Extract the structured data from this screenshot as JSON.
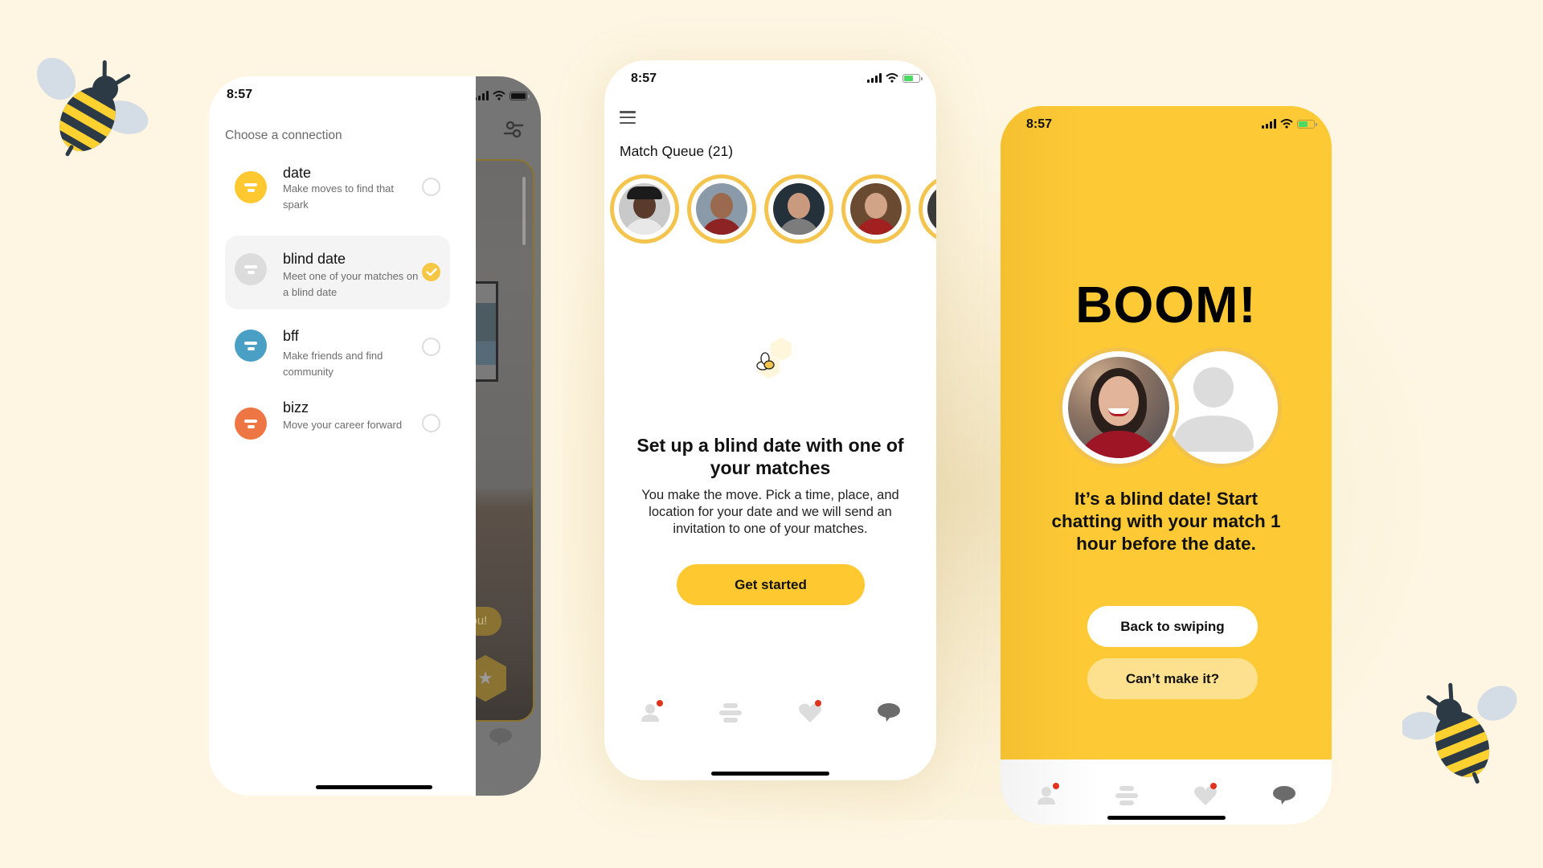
{
  "colors": {
    "background": "#fef6e2",
    "brand_yellow": "#fdc934",
    "date": "#fdc830",
    "blind_date": "#dcdcdc",
    "bff": "#4a9fc4",
    "bizz": "#ee7645",
    "notification": "#e0321c"
  },
  "phone1": {
    "status_time": "8:57",
    "drawer_title": "Choose a connection",
    "connections": [
      {
        "name": "date",
        "description": "Make moves to find that spark",
        "selected": false
      },
      {
        "name": "blind date",
        "description": "Meet one of your matches on a blind date",
        "selected": true
      },
      {
        "name": "bff",
        "description": "Make friends and find community",
        "selected": false
      },
      {
        "name": "bizz",
        "description": "Move your career forward",
        "selected": false
      }
    ],
    "background_bubble_text": "you!"
  },
  "phone2": {
    "status_time": "8:57",
    "queue_title": "Match Queue (21)",
    "queue_count": 21,
    "headline": "Set up a blind date with one of your matches",
    "body": "You make the move. Pick a time, place, and location for your date and we will send an invitation to one of your matches.",
    "cta_label": "Get started",
    "tabs": [
      "profile",
      "connections",
      "liked-you",
      "chats"
    ]
  },
  "phone3": {
    "status_time": "8:57",
    "title": "BOOM!",
    "message": "It’s a blind date! Start chatting with your match 1 hour before the date.",
    "primary_button": "Back to swiping",
    "secondary_button": "Can’t make it?",
    "tabs": [
      "profile",
      "connections",
      "liked-you",
      "chats"
    ]
  }
}
